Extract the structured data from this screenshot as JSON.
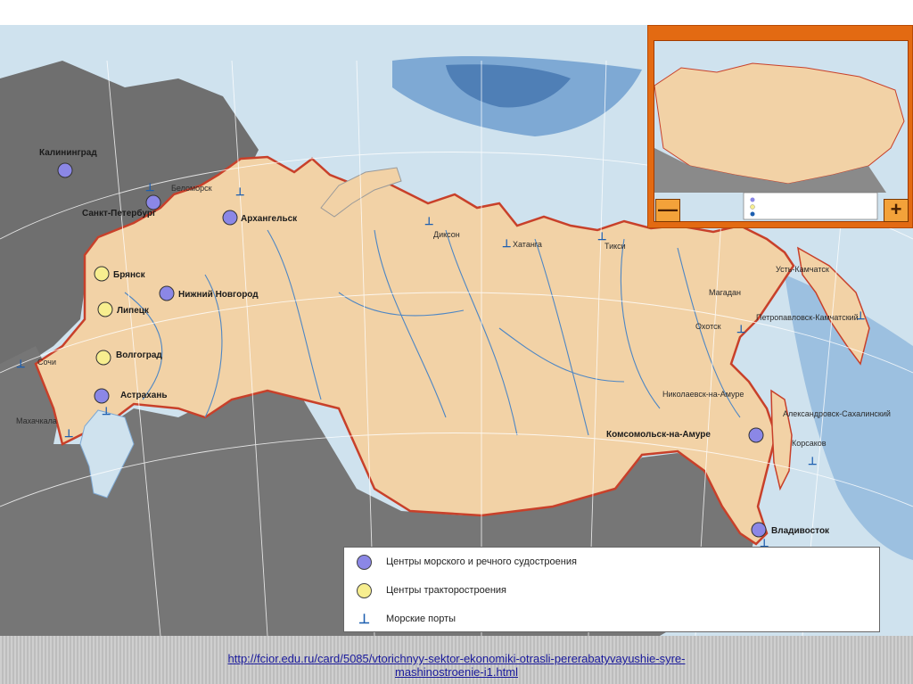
{
  "colors": {
    "sea": "#cfe2ee",
    "deep_sea": "#6d9fcf",
    "russia": "#f2d2a6",
    "neighbors": "#6f6f6f",
    "border": "#c8402a",
    "shipbuilding_dot": "#8b87e6",
    "tractor_dot": "#f7ee8f",
    "inset_frame": "#e36a12"
  },
  "cities": {
    "kaliningrad": "Калининград",
    "saint_petersburg": "Санкт-Петербург",
    "arkhangelsk": "Архангельск",
    "bryansk": "Брянск",
    "nizhny_novgorod": "Нижний Новгород",
    "lipetsk": "Липецк",
    "volgograd": "Волгоград",
    "astrakhan": "Астрахань",
    "komsomolsk": "Комсомольск-на-Амуре",
    "vladivostok": "Владивосток"
  },
  "ports": {
    "belomorsk": "Беломорск",
    "dikson": "Диксон",
    "khatanga": "Хатанга",
    "tiksi": "Тикси",
    "ust_kamchatsk": "Усть-Камчатск",
    "magadan": "Магадан",
    "okhotsk": "Охотск",
    "petropavlovsk": "Петропавловск-Камчатский",
    "nikolaevsk": "Николаевск-на-Амуре",
    "aleksandrovsk": "Александровск-Сахалинский",
    "korsakov": "Корсаков",
    "sochi": "Сочи",
    "makhachkala": "Махачкала"
  },
  "legend": {
    "shipbuilding": "Центры морского и речного судостроения",
    "tractor": "Центры тракторостроения",
    "ports": "Морские порты"
  },
  "inset": {
    "minus_label": "—",
    "plus_label": "+"
  },
  "source": {
    "line1": "http://fcior.edu.ru/card/5085/vtorichnyy-sektor-ekonomiki-otrasli-pererabatyvayushie-syre-",
    "line2": "mashinostroenie-i1.html"
  }
}
